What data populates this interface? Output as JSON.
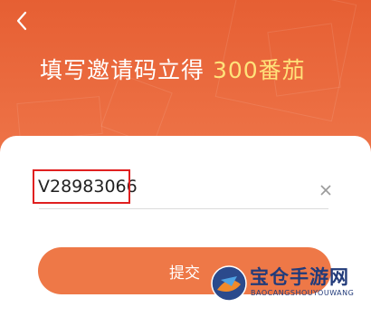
{
  "header": {
    "back_icon": "chevron-left-icon",
    "title_prefix": "填写邀请码立得 ",
    "title_highlight": "300番茄"
  },
  "form": {
    "code_value": "V28983066",
    "clear_icon": "close-icon",
    "submit_label": "提交"
  },
  "watermark": {
    "title": "宝仓手游网",
    "subtitle": "BAOCANGSHOUYOUWANG"
  },
  "colors": {
    "header_bg": "#e8693c",
    "highlight_text": "#ffe27a",
    "submit_bg": "#ee7847",
    "highlight_box": "#e02020"
  }
}
